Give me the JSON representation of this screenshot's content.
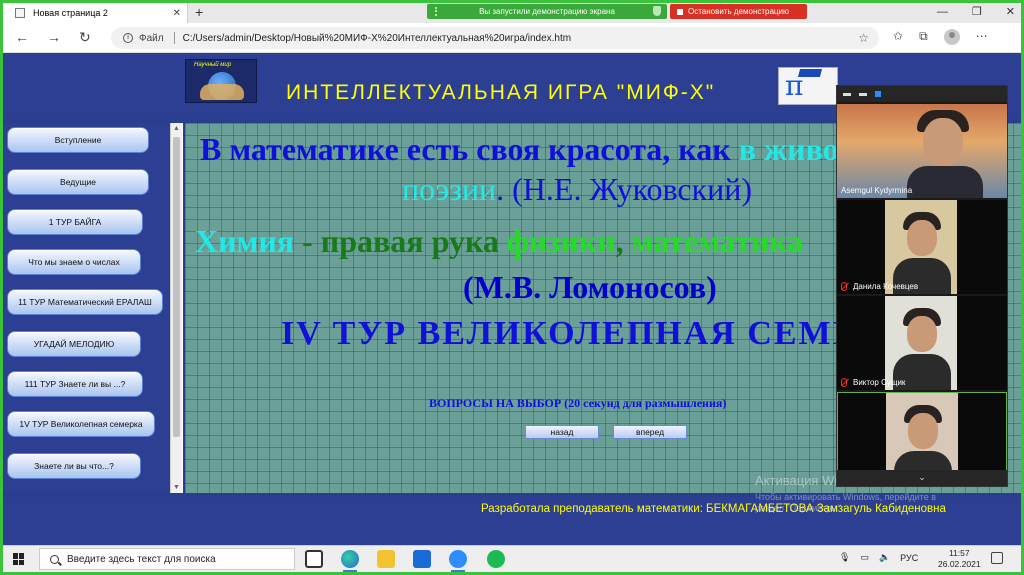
{
  "browser": {
    "tab_title": "Новая страница 2",
    "tab_close": "✕",
    "new_tab": "+",
    "sharing_notice": "Вы запустили демонстрацию экрана",
    "stop_sharing": "Остановить демонстрацию",
    "window_controls": [
      "—",
      "❐",
      "✕"
    ],
    "address": {
      "scheme_label": "Файл",
      "url": "C:/Users/admin/Desktop/Новый%20МИФ-X%20Интеллектуальная%20игра/index.htm"
    },
    "nav": {
      "back": "←",
      "forward": "→",
      "reload": "↻"
    }
  },
  "page": {
    "header_title": "ИНТЕЛЛЕКТУАЛЬНАЯ   ИГРА   \"МИФ-Х\"",
    "logo_caption": "Научный мир",
    "sidebar": [
      "Вступление",
      "Ведущие",
      "1 ТУР  БАЙГА",
      "Что мы знаем о числах",
      "11 ТУР Математический ЕРАЛАШ",
      "УГАДАЙ  МЕЛОДИЮ",
      "111 ТУР Знаете ли вы ...?",
      "1V ТУР Великолепная семерка",
      "Знаете ли вы что...?"
    ],
    "quote1": {
      "part1": "В математике есть своя красота, как ",
      "part2": "в живописи и",
      "part3": "поэзии",
      "part4": ".  (Н.Е. Жуковский)"
    },
    "quote2": {
      "w1": "Химия",
      "w2": " - правая рука ",
      "w3": "физики",
      "w4": ", ",
      "w5": "математика",
      "author": "(М.В. Ломоносов)"
    },
    "round_title": "IV ТУР  ВЕЛИКОЛЕПНАЯ  СЕМЕРКА",
    "choice_text": "ВОПРОСЫ  НА  ВЫБОР  (20 секунд для размышления)",
    "back_button": "назад",
    "forward_button": "вперед",
    "footer": "Разработала преподаватель математики: БЕКМАГАМБЕТОВА  Замзагуль Кабиденовна",
    "watermark": {
      "title": "Активация Windows",
      "line1": "Чтобы активировать Windows, перейдите в",
      "line2": "раздел \"Параметры\"."
    }
  },
  "video_panel": {
    "participants": [
      {
        "name": "Asemgul Kydyrmina",
        "muted": false
      },
      {
        "name": "Данила Кочевцев",
        "muted": true
      },
      {
        "name": "Виктор Сущик",
        "muted": true
      },
      {
        "name": "",
        "muted": false
      }
    ],
    "collapse": "⌄"
  },
  "taskbar": {
    "search_placeholder": "Введите здесь текст для поиска",
    "language": "РУС",
    "time": "11:57",
    "date": "26.02.2021"
  },
  "colors": {
    "frame": "#3cc33c",
    "page_bg": "#2d3f93",
    "content_bg": "#6aa098",
    "title_yellow": "#ffff00",
    "blue_text": "#1010d8",
    "cyan_text": "#22e8e8",
    "green_text": "#1a7a1a",
    "bright_green": "#22dd22"
  }
}
